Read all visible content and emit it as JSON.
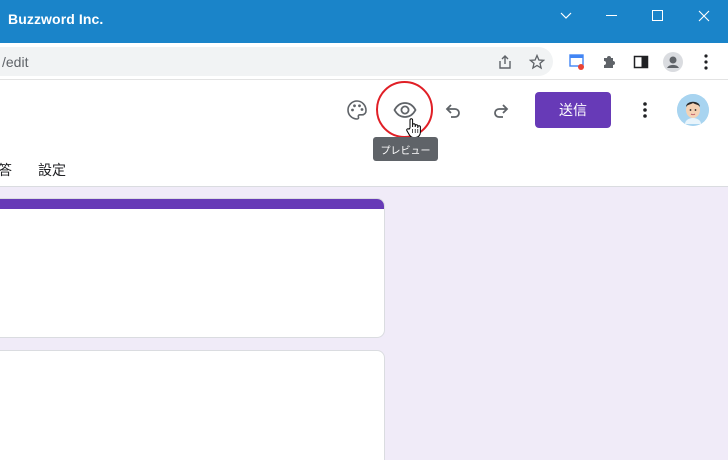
{
  "window": {
    "title": "Buzzword Inc.",
    "controls": [
      "chevron-down-icon",
      "minimize-icon",
      "maximize-icon",
      "close-icon"
    ]
  },
  "browser": {
    "url": "/edit",
    "icons": [
      "share-icon",
      "star-icon",
      "extension-badge-icon",
      "puzzle-icon",
      "sidepanel-icon",
      "profile-icon",
      "kebab-menu-icon"
    ]
  },
  "toolbar": {
    "icons": [
      "palette-icon",
      "eye-icon",
      "undo-icon",
      "redo-icon",
      "more-vert-icon"
    ],
    "send_label": "送信",
    "preview_tooltip": "プレビュー"
  },
  "tabs": {
    "responses_fragment": "答",
    "settings": "設定"
  },
  "colors": {
    "accent": "#673ab7",
    "titlebar": "#1a84c9",
    "background": "#f0ebf8",
    "highlight": "#e01f26"
  }
}
